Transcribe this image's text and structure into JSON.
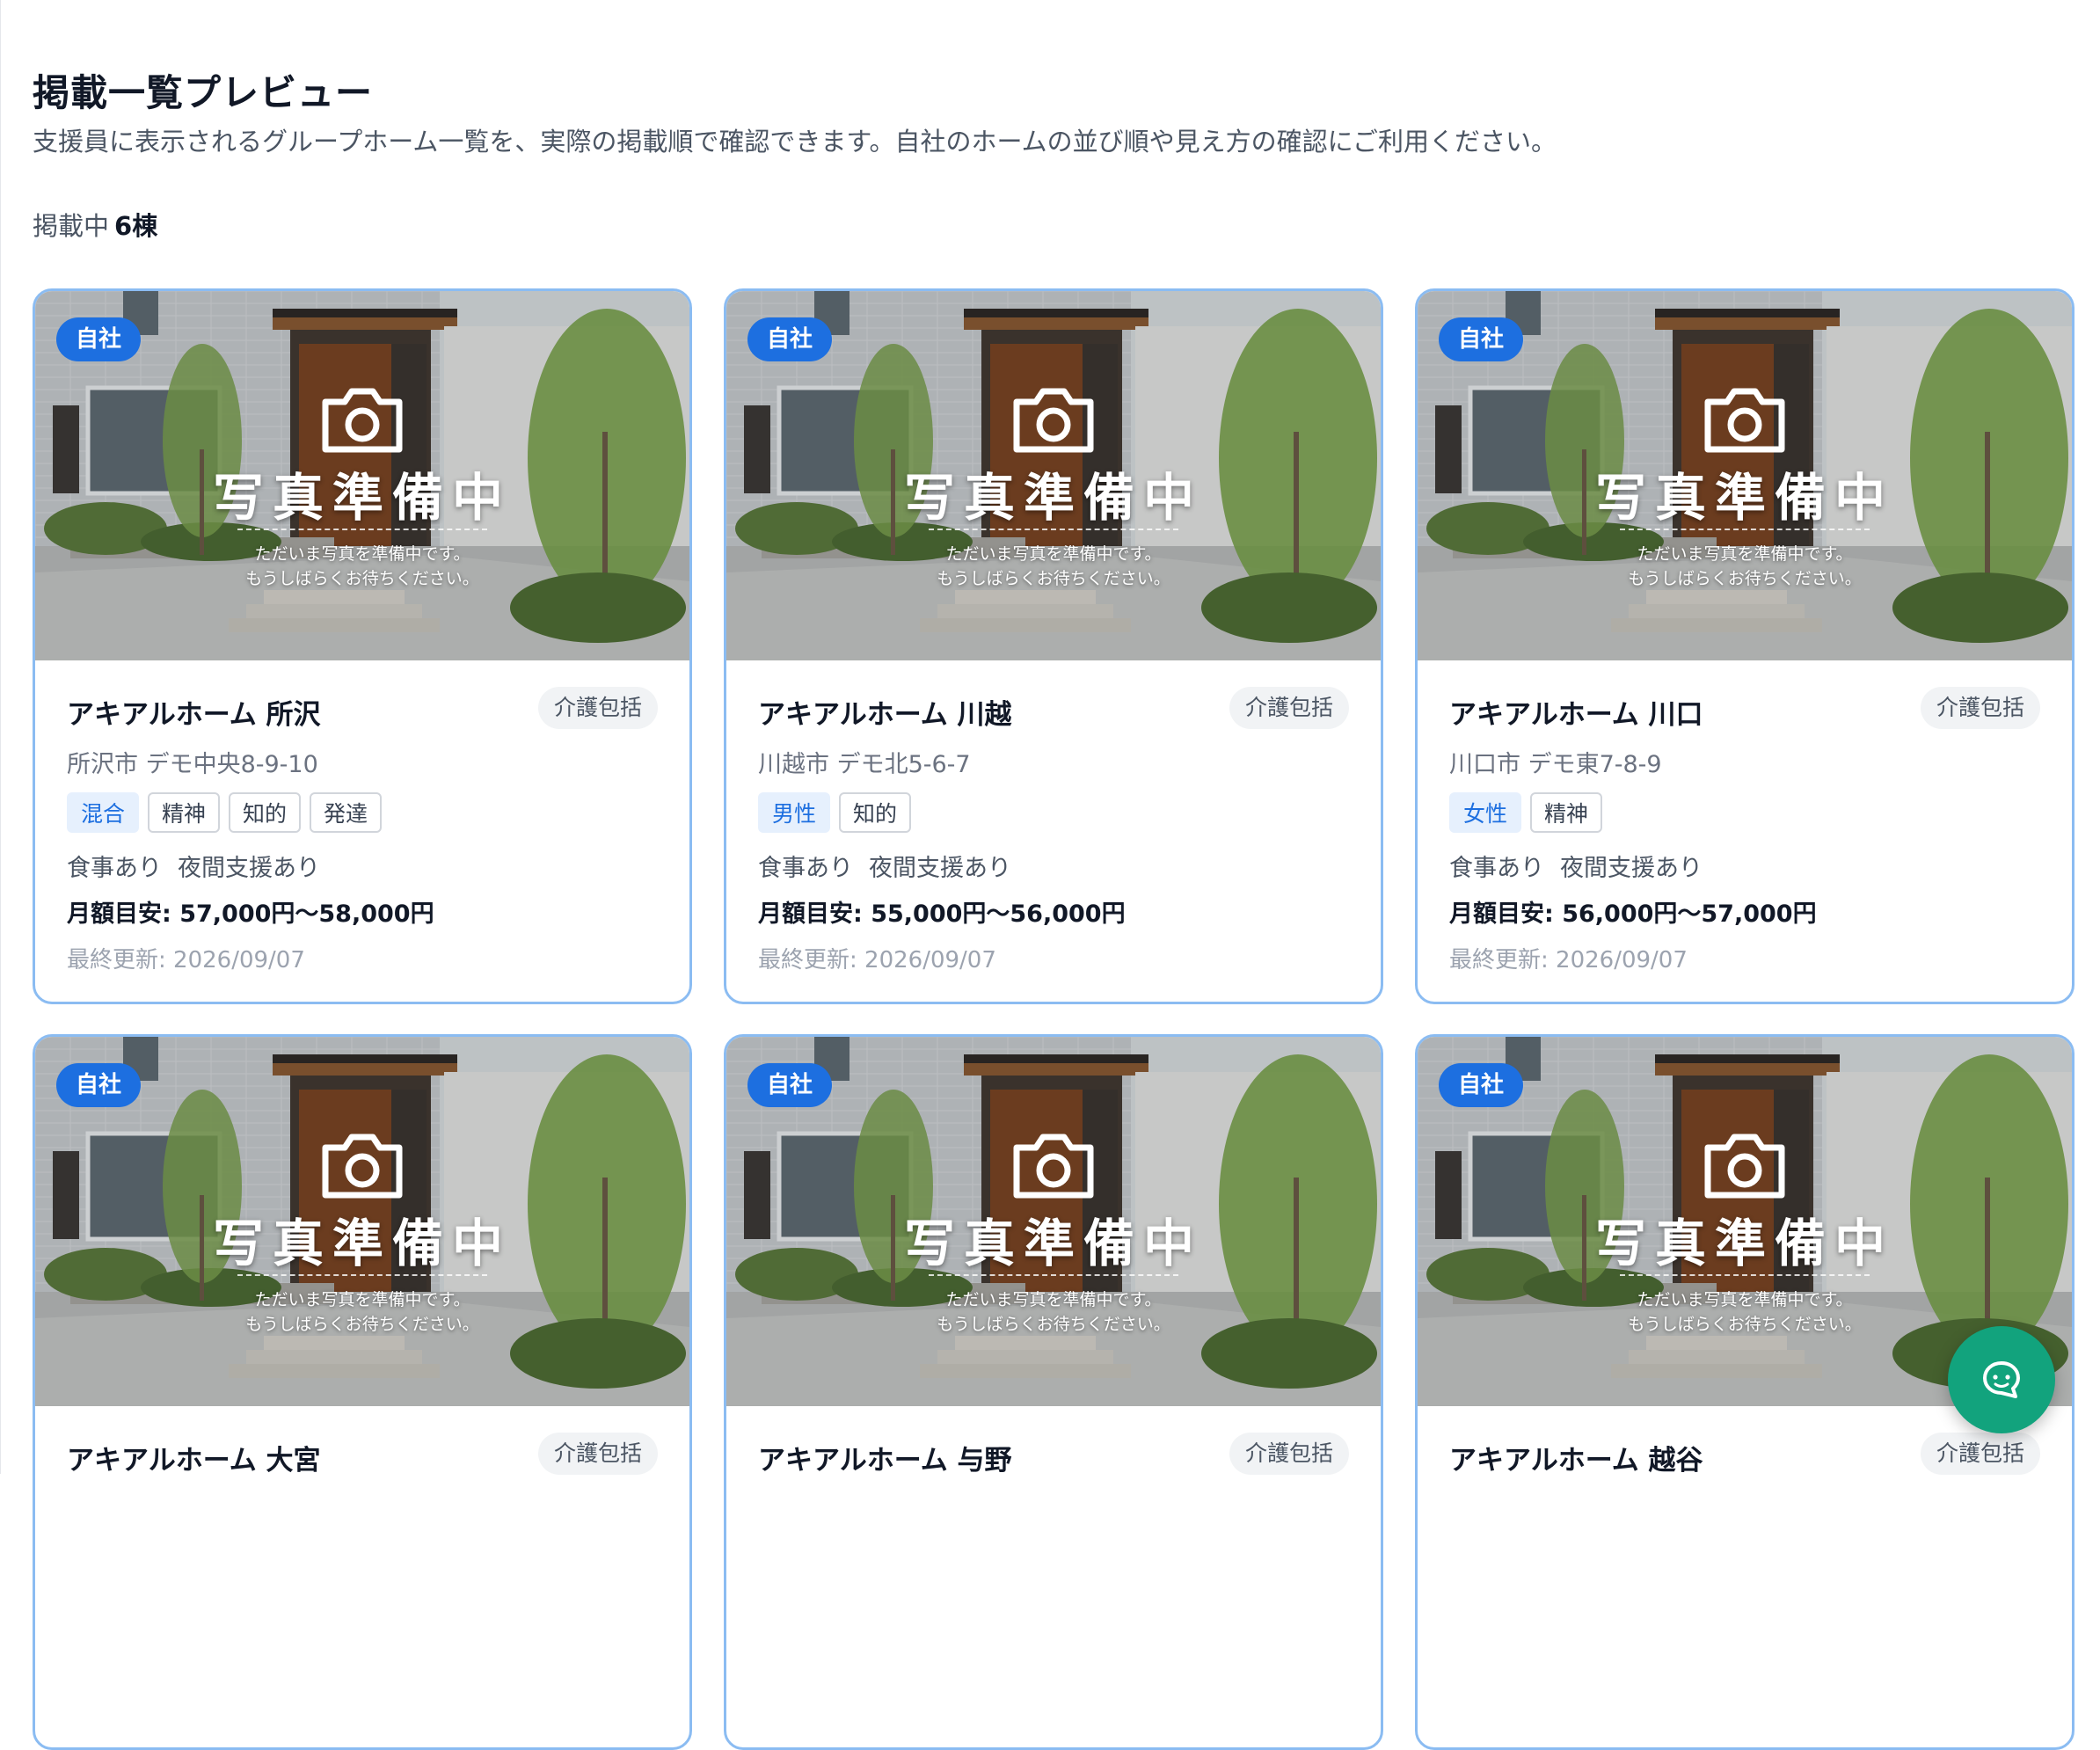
{
  "header": {
    "title": "掲載一覧プレビュー",
    "description": "支援員に表示されるグループホーム一覧を、実際の掲載順で確認できます。自社のホームの並び順や見え方の確認にご利用ください。",
    "count_label": "掲載中",
    "count_value": "6棟"
  },
  "photo_placeholder": {
    "badge": "自社",
    "title": "写真準備中",
    "line1": "ただいま写真を準備中です。",
    "line2": "もうしばらくお待ちください。",
    "icon": "camera-icon"
  },
  "cards": [
    {
      "name": "アキアルホーム 所沢",
      "care": "介護包括",
      "address": "所沢市 デモ中央8-9-10",
      "tags": [
        {
          "label": "混合",
          "primary": true
        },
        {
          "label": "精神"
        },
        {
          "label": "知的"
        },
        {
          "label": "発達"
        }
      ],
      "meal": "食事あり",
      "night": "夜間支援あり",
      "price": "月額目安: 57,000円〜58,000円",
      "updated": "最終更新: 2026/09/07"
    },
    {
      "name": "アキアルホーム 川越",
      "care": "介護包括",
      "address": "川越市 デモ北5-6-7",
      "tags": [
        {
          "label": "男性",
          "primary": true
        },
        {
          "label": "知的"
        }
      ],
      "meal": "食事あり",
      "night": "夜間支援あり",
      "price": "月額目安: 55,000円〜56,000円",
      "updated": "最終更新: 2026/09/07"
    },
    {
      "name": "アキアルホーム 川口",
      "care": "介護包括",
      "address": "川口市 デモ東7-8-9",
      "tags": [
        {
          "label": "女性",
          "primary": true
        },
        {
          "label": "精神"
        }
      ],
      "meal": "食事あり",
      "night": "夜間支援あり",
      "price": "月額目安: 56,000円〜57,000円",
      "updated": "最終更新: 2026/09/07"
    },
    {
      "name": "アキアルホーム 大宮",
      "care": "介護包括"
    },
    {
      "name": "アキアルホーム 与野",
      "care": "介護包括"
    },
    {
      "name": "アキアルホーム 越谷",
      "care": "介護包括"
    }
  ],
  "chat_button": {
    "icon": "chat-bubble-icon"
  },
  "colors": {
    "accent": "#1d6fe0",
    "card_border": "#8bbcf2",
    "chat": "#12a37d"
  }
}
